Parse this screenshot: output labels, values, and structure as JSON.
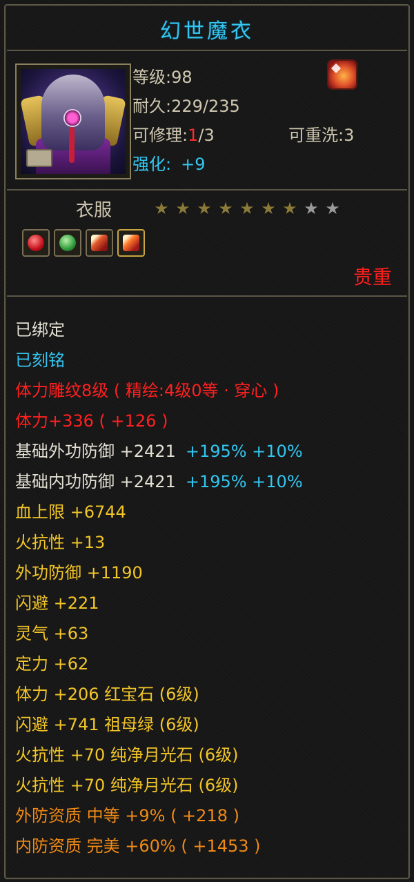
{
  "item": {
    "name": "幻世魔衣",
    "level_label": "等级",
    "level_value": ":98",
    "durability_label": "耐久",
    "durability_value": ":229/235",
    "repair_label": "可修理",
    "repair_sep": ":",
    "repair_used": "1",
    "repair_max": "/3",
    "rewash_label": "可重洗",
    "rewash_value": ":3",
    "enhance_label": "强化:",
    "enhance_value": "+9",
    "badge_icon": "flame-emblem-icon",
    "type": "衣服",
    "stars_total": 9,
    "stars_filled": 7,
    "gems": [
      "ruby-gem-icon",
      "emerald-gem-icon",
      "moonstone-gem-icon",
      "moonstone-gem-icon"
    ],
    "rarity": "贵重"
  },
  "colors": {
    "title": "#33c6f1",
    "cyan": "#33c6f1",
    "red": "#ff2020",
    "yellow": "#f2c528",
    "orange": "#f08a16",
    "white": "#e3e0d4",
    "border": "#5b5646"
  },
  "attributes": [
    {
      "text": "已绑定",
      "color": "white"
    },
    {
      "text": "已刻铭",
      "color": "cyan"
    },
    {
      "text": "体力雕纹8级 ( 精绘:4级0等 · 穿心 )",
      "color": "red"
    },
    {
      "text": "体力+336 ( +126 )",
      "color": "red"
    },
    {
      "main": "基础外功防御 +2421",
      "extra": "+195% +10%",
      "main_color": "white",
      "extra_color": "cyan"
    },
    {
      "main": "基础内功防御 +2421",
      "extra": "+195% +10%",
      "main_color": "white",
      "extra_color": "cyan"
    },
    {
      "text": "血上限 +6744",
      "color": "yellow"
    },
    {
      "text": "火抗性 +13",
      "color": "yellow"
    },
    {
      "text": "外功防御 +1190",
      "color": "yellow"
    },
    {
      "text": "闪避 +221",
      "color": "yellow"
    },
    {
      "text": "灵气 +63",
      "color": "yellow"
    },
    {
      "text": "定力 +62",
      "color": "yellow"
    },
    {
      "text": "体力 +206 红宝石 (6级)",
      "color": "yellow"
    },
    {
      "text": "闪避 +741 祖母绿 (6级)",
      "color": "yellow"
    },
    {
      "text": "火抗性 +70 纯净月光石 (6级)",
      "color": "yellow"
    },
    {
      "text": "火抗性 +70 纯净月光石 (6级)",
      "color": "yellow"
    },
    {
      "text": "外防资质 中等 +9% ( +218 )",
      "color": "orange"
    },
    {
      "text": "内防资质 完美 +60% ( +1453 )",
      "color": "orange"
    }
  ]
}
